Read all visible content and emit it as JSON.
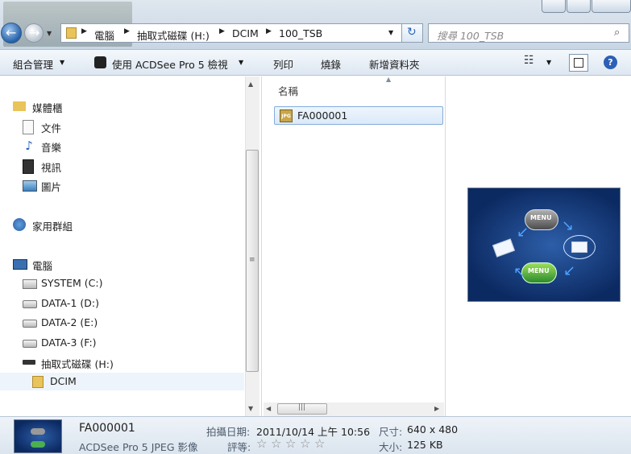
{
  "address_bar": {
    "crumbs": [
      "電腦",
      "抽取式磁碟 (H:)",
      "DCIM",
      "100_TSB"
    ]
  },
  "search": {
    "placeholder": "搜尋 100_TSB"
  },
  "toolbar": {
    "organize": "組合管理",
    "open_with": "使用 ACDSee Pro 5 檢視",
    "print": "列印",
    "burn": "燒錄",
    "new_folder": "新增資料夾"
  },
  "nav": {
    "libraries": "媒體櫃",
    "documents": "文件",
    "music": "音樂",
    "videos": "視訊",
    "pictures": "圖片",
    "homegroup": "家用群組",
    "computer": "電腦",
    "drive_c": "SYSTEM (C:)",
    "drive_d": "DATA-1 (D:)",
    "drive_e": "DATA-2 (E:)",
    "drive_f": "DATA-3 (F:)",
    "drive_h": "抽取式磁碟 (H:)",
    "dcim": "DCIM"
  },
  "file_list": {
    "column_name": "名稱",
    "files": [
      {
        "name": "FA000001",
        "icon": "jpg-file-icon"
      }
    ]
  },
  "preview_image": {
    "labels": [
      "MENU",
      "MENU"
    ]
  },
  "details": {
    "file_name": "FA000001",
    "file_type": "ACDSee Pro 5 JPEG 影像",
    "date_label": "拍攝日期:",
    "date_value": "2011/10/14 上午 10:56",
    "rating_label": "評等:",
    "rating_stars": 0,
    "dimensions_label": "尺寸:",
    "dimensions_value": "640 x 480",
    "size_label": "大小:",
    "size_value": "125 KB"
  }
}
